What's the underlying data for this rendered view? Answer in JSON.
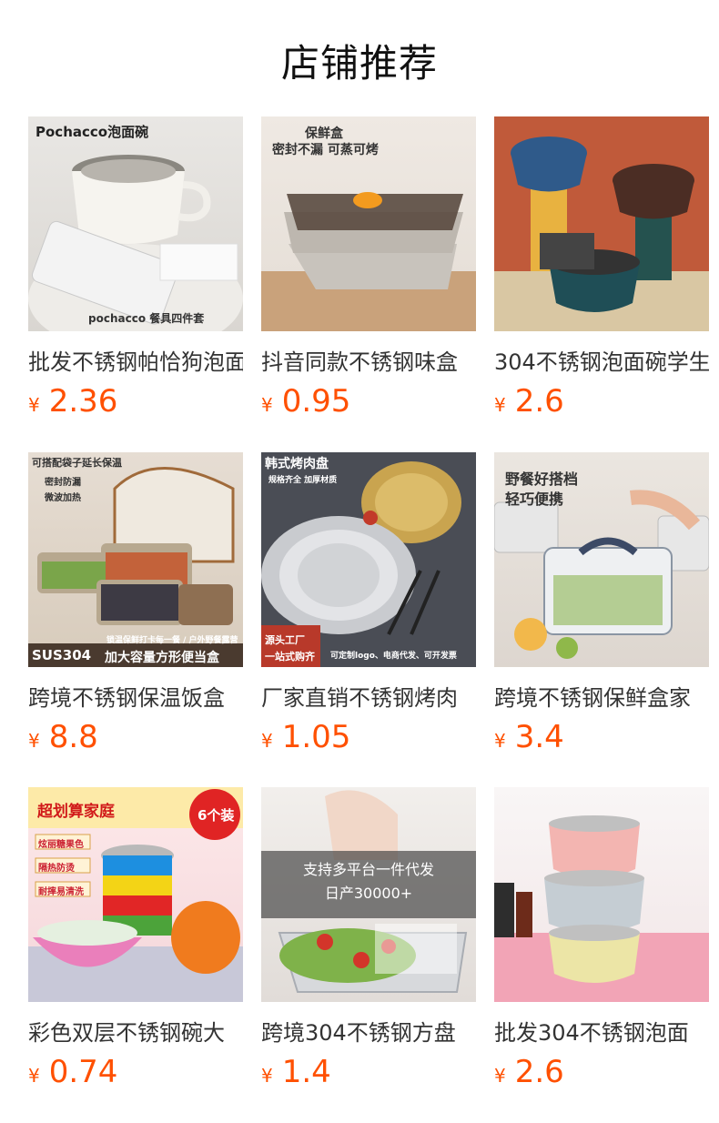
{
  "section_title": "店铺推荐",
  "currency": "¥",
  "products": [
    {
      "name": "批发不锈钢帕恰狗泡面碗",
      "price": "2.36",
      "image_text": [
        "Pochacco泡面碗",
        "pochacco 餐具四件套"
      ]
    },
    {
      "name": "抖音同款不锈钢味盒",
      "price": "0.95",
      "image_text": [
        "保鲜盒",
        "密封不漏 可蒸可烤"
      ]
    },
    {
      "name": "304不锈钢泡面碗学生",
      "price": "2.6",
      "image_text": []
    },
    {
      "name": "跨境不锈钢保温饭盒",
      "price": "8.8",
      "image_text": [
        "可搭配袋子延长保温",
        "密封防漏",
        "微波加热",
        "锁温保鲜打卡每一餐 / 户外野餐露营",
        "SUS304",
        "加大容量方形便当盒"
      ]
    },
    {
      "name": "厂家直销不锈钢烤肉",
      "price": "1.05",
      "image_text": [
        "韩式烤肉盘",
        "规格齐全 加厚材质",
        "源头工厂",
        "一站式购齐",
        "可定制logo、电商代发、可开发票"
      ]
    },
    {
      "name": "跨境不锈钢保鲜盒家",
      "price": "3.4",
      "image_text": [
        "野餐好搭档",
        "轻巧便携"
      ]
    },
    {
      "name": "彩色双层不锈钢碗大",
      "price": "0.74",
      "image_text": [
        "超划算家庭",
        "6个装",
        "炫丽糖果色",
        "隔热防烫",
        "耐摔易清洗"
      ]
    },
    {
      "name": "跨境304不锈钢方盘",
      "price": "1.4",
      "image_text": [
        "支持多平台一件代发",
        "日产30000+"
      ]
    },
    {
      "name": "批发304不锈钢泡面",
      "price": "2.6",
      "image_text": []
    }
  ],
  "colors": {
    "price": "#ff5000"
  }
}
